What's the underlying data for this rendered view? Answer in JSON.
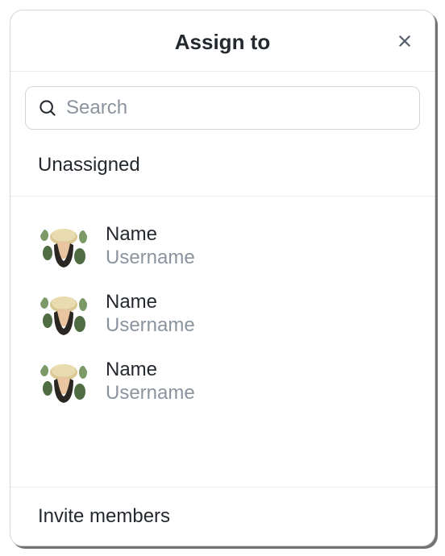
{
  "dialog": {
    "title": "Assign to",
    "search_placeholder": "Search",
    "unassigned_label": "Unassigned",
    "invite_label": "Invite members"
  },
  "members": [
    {
      "name": "Name",
      "username": "Username"
    },
    {
      "name": "Name",
      "username": "Username"
    },
    {
      "name": "Name",
      "username": "Username"
    }
  ]
}
